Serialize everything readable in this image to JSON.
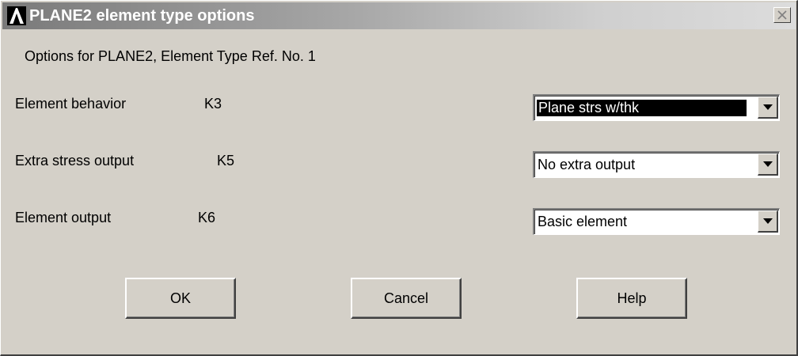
{
  "window": {
    "title": "PLANE2 element type options",
    "logo_icon": "ansys-logo-icon",
    "close_icon": "close-icon"
  },
  "dialog": {
    "subtitle": "Options for PLANE2, Element Type Ref. No. 1",
    "options": [
      {
        "label": "Element behavior",
        "key": "K3",
        "value": "Plane strs w/thk",
        "focused": true
      },
      {
        "label": "Extra stress output",
        "key": "K5",
        "value": "No extra output",
        "focused": false
      },
      {
        "label": "Element output",
        "key": "K6",
        "value": "Basic element",
        "focused": false
      }
    ]
  },
  "buttons": {
    "ok": "OK",
    "cancel": "Cancel",
    "help": "Help"
  },
  "colors": {
    "face": "#d4d0c8",
    "title_gradient_start": "#7a7a7a",
    "title_gradient_end": "#dcdcdc",
    "selection": "#000000"
  }
}
